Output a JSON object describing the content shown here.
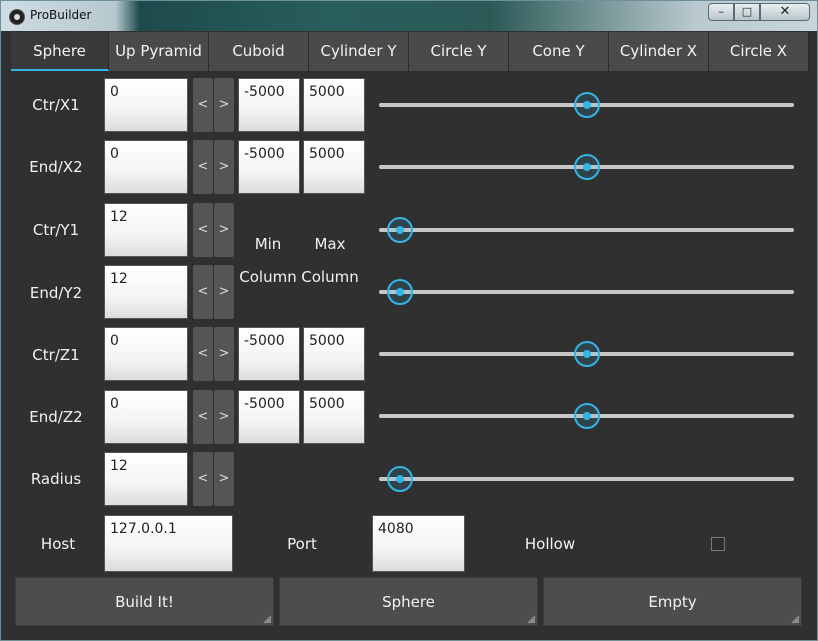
{
  "window": {
    "title": "ProBuilder",
    "minimize": "–",
    "maximize": "□",
    "close": "✕"
  },
  "tabs": [
    {
      "label": "Sphere",
      "active": true
    },
    {
      "label": "Up Pyramid"
    },
    {
      "label": "Cuboid"
    },
    {
      "label": "Cylinder Y"
    },
    {
      "label": "Circle Y"
    },
    {
      "label": "Cone Y"
    },
    {
      "label": "Cylinder X"
    },
    {
      "label": "Circle X"
    }
  ],
  "rows": [
    {
      "label": "Ctr/X1",
      "value": "0",
      "min": "-5000",
      "max": "5000",
      "slider": 0.5
    },
    {
      "label": "End/X2",
      "value": "0",
      "min": "-5000",
      "max": "5000",
      "slider": 0.5
    },
    {
      "label": "Ctr/Y1",
      "value": "12",
      "slider": 0.05
    },
    {
      "label": "End/Y2",
      "value": "12",
      "slider": 0.05
    },
    {
      "label": "Ctr/Z1",
      "value": "0",
      "min": "-5000",
      "max": "5000",
      "slider": 0.5
    },
    {
      "label": "End/Z2",
      "value": "0",
      "min": "-5000",
      "max": "5000",
      "slider": 0.5
    },
    {
      "label": "Radius",
      "value": "12",
      "slider": 0.05
    }
  ],
  "arrows": {
    "left": "<",
    "right": ">"
  },
  "column_headers": {
    "min": "Min",
    "max": "Max",
    "column": "Column"
  },
  "connection": {
    "host_label": "Host",
    "host_value": "127.0.0.1",
    "port_label": "Port",
    "port_value": "4080",
    "hollow_label": "Hollow",
    "hollow_checked": false
  },
  "buttons": {
    "build": "Build It!",
    "shape": "Sphere",
    "empty": "Empty"
  },
  "colors": {
    "accent": "#33b5e5",
    "background": "#303030"
  }
}
